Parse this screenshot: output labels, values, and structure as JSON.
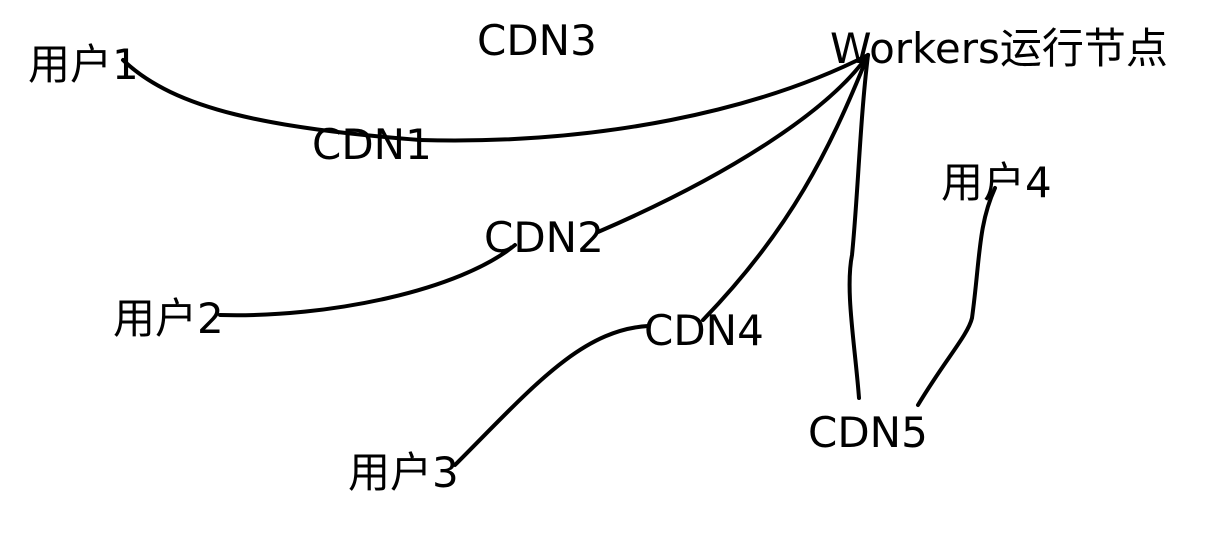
{
  "nodes": {
    "user1": "用户1",
    "user2": "用户2",
    "user3": "用户3",
    "user4": "用户4",
    "cdn1": "CDN1",
    "cdn2": "CDN2",
    "cdn3": "CDN3",
    "cdn4": "CDN4",
    "cdn5": "CDN5",
    "workers": "Workers运行节点"
  },
  "edges": [
    {
      "from": "user1",
      "to": "cdn1"
    },
    {
      "from": "cdn1",
      "to": "workers"
    },
    {
      "from": "user2",
      "to": "cdn2"
    },
    {
      "from": "cdn2",
      "to": "workers"
    },
    {
      "from": "user3",
      "to": "cdn4"
    },
    {
      "from": "cdn4",
      "to": "workers"
    },
    {
      "from": "cdn5",
      "to": "workers"
    },
    {
      "from": "user4",
      "to": "cdn5"
    }
  ],
  "colors": {
    "line": "#000000",
    "text": "#000000",
    "background": "#ffffff"
  }
}
